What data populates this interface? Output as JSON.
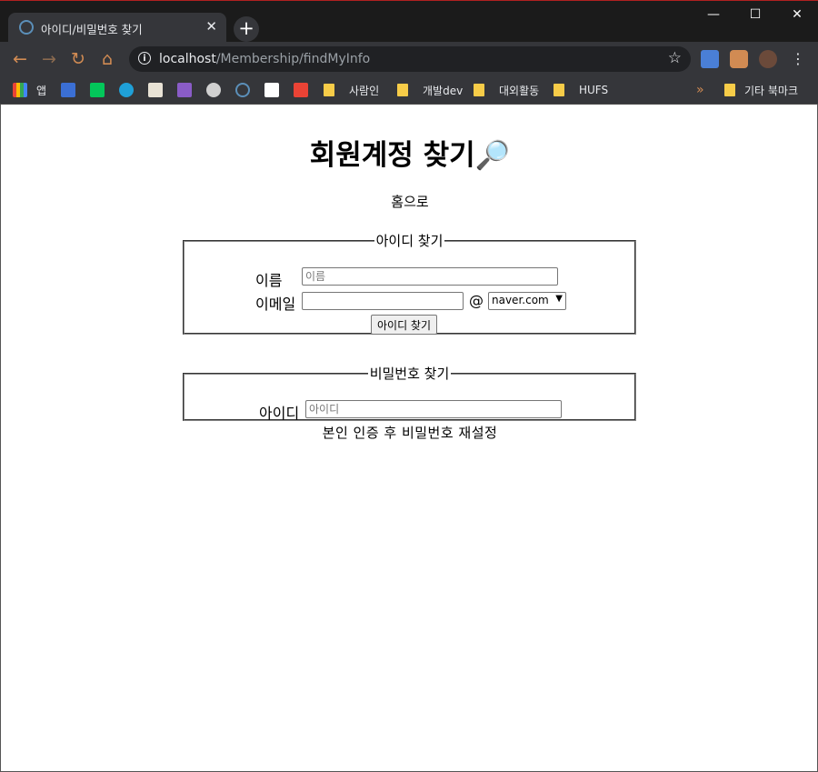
{
  "browser": {
    "tab_title": "아이디/비밀번호 찾기",
    "url_host": "localhost",
    "url_path": "/Membership/findMyInfo",
    "bookmarks": {
      "apps": "앱",
      "folder1": "사람인",
      "folder2": "개발dev",
      "folder3": "대외활동",
      "folder4": "HUFS",
      "more": "»",
      "other": "기타 북마크"
    }
  },
  "page": {
    "title": "회원계정 찾기",
    "title_icon": "🔎",
    "home_link": "홈으로",
    "find_id": {
      "legend": "아이디 찾기",
      "name_label": "이름",
      "name_placeholder": "이름",
      "email_label": "이메일",
      "at": "@",
      "domain_selected": "naver.com",
      "submit": "아이디 찾기"
    },
    "find_pw": {
      "legend": "비밀번호 찾기",
      "id_label": "아이디",
      "id_placeholder": "아이디"
    },
    "reset_text": "본인 인증 후 비밀번호 재설정"
  }
}
